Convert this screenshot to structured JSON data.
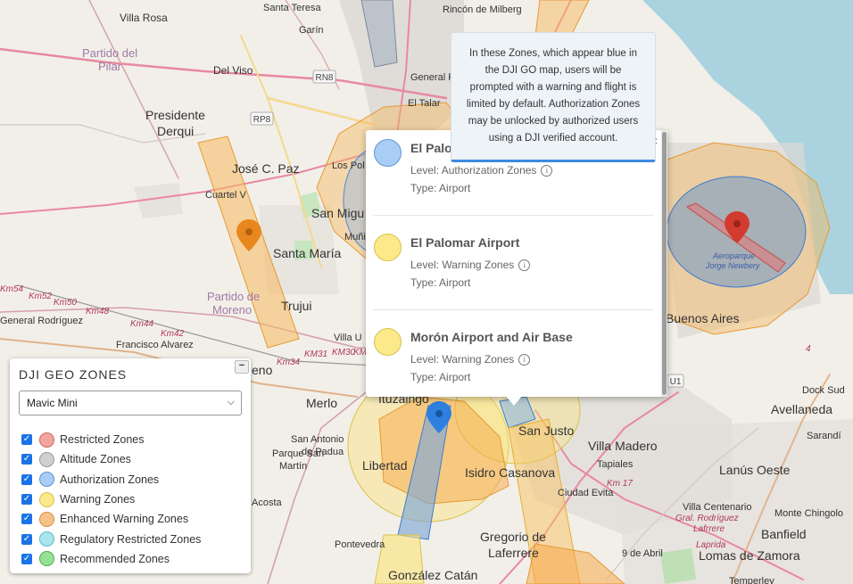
{
  "map": {
    "labels": {
      "villa_rosa": "Villa Rosa",
      "rincon": "Rincón de Milberg",
      "santa_teresa": "Santa Teresa",
      "garin": "Garín",
      "partido_pilar": "Partido del",
      "partido_pilar2": "Pilar",
      "del_viso": "Del Viso",
      "presidente": "Presidente",
      "derqui": "Derqui",
      "general": "General R",
      "el_talar": "El Talar",
      "jose_c_paz": "José C. Paz",
      "los_pol": "Los Pol",
      "san_miguel": "San Migu",
      "muniz": "Muñiz",
      "cuartel_v": "Cuartel V",
      "santa_maria": "Santa María",
      "partido_moreno": "Partido de",
      "partido_moreno2": "Moreno",
      "trujui": "Trujui",
      "general_rodriguez": "General Rodríguez",
      "francisco_alvarez": "Francisco Alvarez",
      "villa_u": "Villa U",
      "buenos_aires": "Buenos Aires",
      "aeroparque": "Aeroparque",
      "jorge_newbery": "Jorge Newbery",
      "merlo": "Merlo",
      "moreno": "eno",
      "ituzaingo": "Ituzaingó",
      "libertad": "Libertad",
      "san_justo": "San Justo",
      "villa_madero": "Villa Madero",
      "tapiales": "Tapiales",
      "isidro_casanova": "Isidro Casanova",
      "ciudad_evita": "Ciudad Evita",
      "san_antonio": "San Antonio",
      "de_padua": "de Padua",
      "parque_san": "Parque San",
      "martin": "Martín",
      "acosta": "Acosta",
      "pontevedra": "Pontevedra",
      "gregorio": "Gregorio de",
      "laferrere": "Laferrere",
      "gonzalez_catan": "González Catán",
      "nueve_abril": "9 de Abril",
      "dock_sud": "Dock Sud",
      "avellaneda": "Avellaneda",
      "sarandi": "Sarandí",
      "lanus": "Lanús Oeste",
      "villa_centenario": "Villa Centenario",
      "gral_rodriguez": "Gral. Rodríguez",
      "lafrrere": "Lafrrere",
      "banfield": "Banfield",
      "monte_chingolo": "Monte Chingolo",
      "lomas": "Lomas de Zamora",
      "temperley": "Temperley",
      "laprida": "Laprida",
      "km54": "Km54",
      "km52": "Km52",
      "km50": "Km50",
      "km48": "Km48",
      "km44": "Km44",
      "km42": "Km42",
      "km34": "Km34",
      "km31": "KM31",
      "km30": "KM30",
      "km": "KM",
      "km17": "Km 17",
      "rn8": "RN8",
      "rp8": "RP8",
      "u1": "U1",
      "four": "4"
    }
  },
  "legend": {
    "title": "DJI GEO ZONES",
    "collapse": "−",
    "aircraft": "Mavic Mini",
    "items": [
      {
        "label": "Restricted Zones",
        "fill": "#f2a49e",
        "stroke": "#c86a62"
      },
      {
        "label": "Altitude Zones",
        "fill": "#cfcfcf",
        "stroke": "#9a9a9a"
      },
      {
        "label": "Authorization Zones",
        "fill": "#a9cdf5",
        "stroke": "#5c95d6"
      },
      {
        "label": "Warning Zones",
        "fill": "#fbe98a",
        "stroke": "#d8c24a"
      },
      {
        "label": "Enhanced Warning Zones",
        "fill": "#f7c28a",
        "stroke": "#d78f41"
      },
      {
        "label": "Regulatory Restricted Zones",
        "fill": "#a9e5ef",
        "stroke": "#5fb9c9"
      },
      {
        "label": "Recommended Zones",
        "fill": "#96e294",
        "stroke": "#4dad4a"
      }
    ]
  },
  "popup": {
    "close": "×",
    "zones": [
      {
        "name": "El Palomar Airport",
        "level": "Level: Authorization Zones",
        "type": "Type: Airport",
        "fill": "#a9cdf5",
        "stroke": "#5c95d6"
      },
      {
        "name": "El Palomar Airport",
        "level": "Level: Warning Zones",
        "type": "Type: Airport",
        "fill": "#fbe98a",
        "stroke": "#d8c24a"
      },
      {
        "name": "Morón Airport and Air Base",
        "level": "Level: Warning Zones",
        "type": "Type: Airport",
        "fill": "#fbe98a",
        "stroke": "#d8c24a"
      }
    ],
    "info_glyph": "i"
  },
  "tooltip": {
    "text": "In these Zones, which appear blue in the DJI GO map, users will be prompted with a warning and flight is limited by default. Authorization Zones may be unlocked by authorized users using a DJI verified account."
  }
}
